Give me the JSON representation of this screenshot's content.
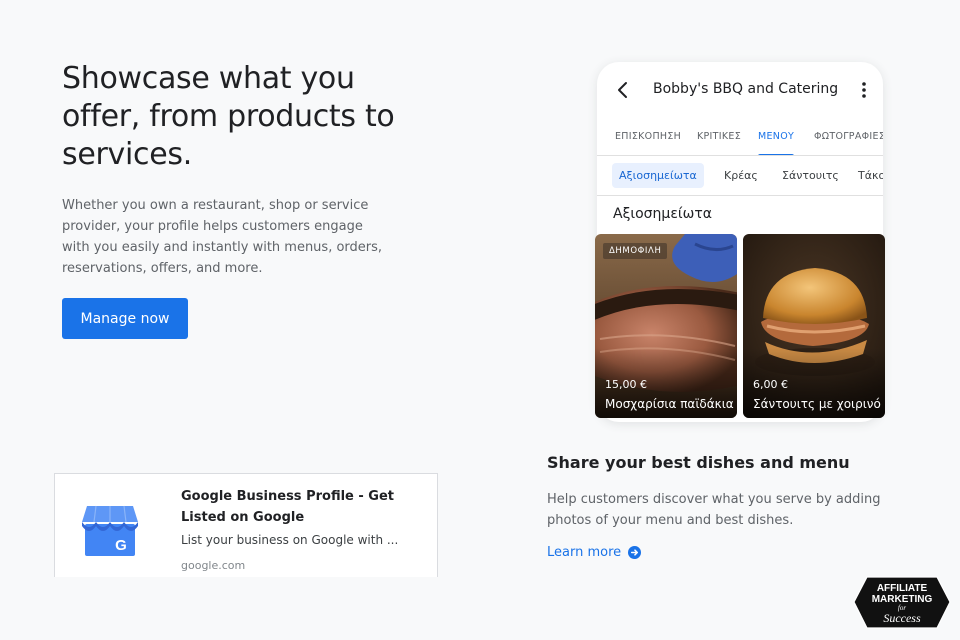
{
  "hero": {
    "title": "Showcase what you offer, from products to services.",
    "description": "Whether you own a restaurant, shop or service provider, your profile helps customers engage with you easily and instantly with menus, orders, reservations, offers, and more.",
    "cta_label": "Manage now"
  },
  "phone": {
    "business_name": "Bobby's BBQ and Catering",
    "tabs": [
      {
        "label": "ΕΠΙΣΚΟΠΗΣΗ"
      },
      {
        "label": "ΚΡΙΤΙΚΕΣ"
      },
      {
        "label": "ΜΕΝΟΥ"
      },
      {
        "label": "ΦΩΤΟΓΡΑΦΙΕΣ"
      }
    ],
    "active_tab": "ΜΕΝΟΥ",
    "chips": [
      {
        "label": "Αξιοσημείωτα"
      },
      {
        "label": "Κρέας"
      },
      {
        "label": "Σάντουιτς"
      },
      {
        "label": "Τάκο"
      }
    ],
    "section_title": "Αξιοσημείωτα",
    "dishes": [
      {
        "badge": "ΔΗΜΟΦΙΛΗ",
        "price": "15,00 €",
        "name": "Μοσχαρίσια παϊδάκια"
      },
      {
        "price": "6,00 €",
        "name": "Σάντουιτς με χοιρινό"
      }
    ]
  },
  "feature": {
    "title": "Share your best dishes and menu",
    "description": "Help customers discover what you serve by adding photos of your menu and best dishes.",
    "link_label": "Learn more"
  },
  "preview": {
    "title": "Google Business Profile - Get Listed on Google",
    "description": "List your business on Google with ...",
    "domain": "google.com"
  },
  "watermark": {
    "line1": "AFFILIATE",
    "line2": "MARKETING",
    "line3": "for",
    "line4": "Success"
  },
  "colors": {
    "accent": "#1a73e8",
    "background": "#f8f9fa",
    "text_primary": "#202124",
    "text_secondary": "#5f6368"
  },
  "icons": [
    "back-arrow-icon",
    "more-vert-icon",
    "arrow-circle-right-icon",
    "google-business-profile-icon"
  ]
}
